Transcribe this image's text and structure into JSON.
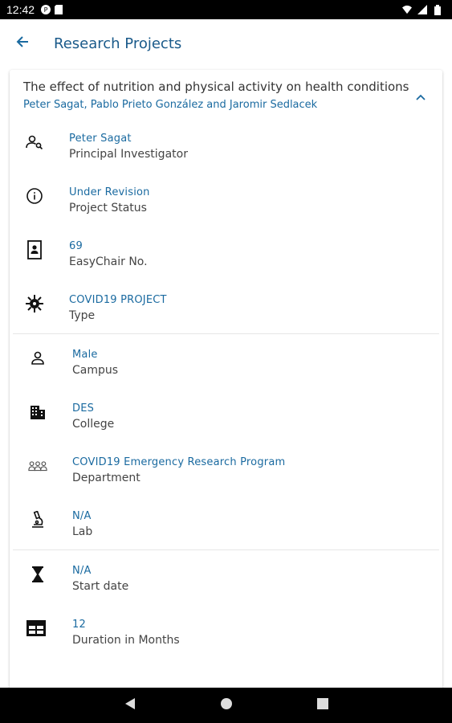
{
  "status_bar": {
    "time": "12:42",
    "left_icons": [
      "notification-p-icon",
      "sd-card-icon"
    ],
    "right_icons": [
      "wifi-icon",
      "signal-icon",
      "battery-icon"
    ]
  },
  "app_bar": {
    "back_icon": "arrow-left-icon",
    "title": "Research Projects"
  },
  "project": {
    "title": "The effect of nutrition and physical activity on health conditions",
    "authors": "Peter Sagat, Pablo Prieto González and Jaromir Sedlacek",
    "expanded_icon": "chevron-up-icon"
  },
  "sections": [
    {
      "rows": [
        {
          "icon": "person-search-icon",
          "value": "Peter Sagat",
          "label": "Principal Investigator"
        },
        {
          "icon": "info-icon",
          "value": "Under Revision",
          "label": "Project Status"
        },
        {
          "icon": "badge-icon",
          "value": "69",
          "label": "EasyChair No."
        },
        {
          "icon": "virus-icon",
          "value": "COVID19 PROJECT",
          "label": "Type"
        }
      ]
    },
    {
      "rows": [
        {
          "icon": "person-icon",
          "value": "Male",
          "label": "Campus"
        },
        {
          "icon": "building-icon",
          "value": "DES",
          "label": "College"
        },
        {
          "icon": "group-icon",
          "value": "COVID19 Emergency Research Program",
          "label": "Department"
        },
        {
          "icon": "microscope-icon",
          "value": "N/A",
          "label": "Lab"
        }
      ]
    },
    {
      "rows": [
        {
          "icon": "hourglass-icon",
          "value": "N/A",
          "label": "Start date"
        },
        {
          "icon": "table-icon",
          "value": "12",
          "label": "Duration in Months"
        }
      ]
    }
  ],
  "nav_bar": {
    "back_icon": "nav-back-icon",
    "home_icon": "nav-home-icon",
    "recents_icon": "nav-recents-icon"
  },
  "colors": {
    "accent": "#1a6aa0",
    "title": "#1a5a8a"
  }
}
